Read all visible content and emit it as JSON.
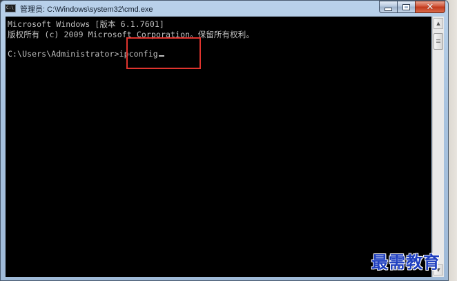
{
  "window": {
    "title": "管理员: C:\\Windows\\system32\\cmd.exe",
    "icon": "cmd-icon",
    "icon_label": "C:\\",
    "controls": {
      "minimize_icon": "minimize-icon",
      "maximize_icon": "maximize-icon",
      "close_icon": "close-icon",
      "close_glyph": "✕"
    }
  },
  "console": {
    "line1": "Microsoft Windows [版本 6.1.7601]",
    "line2": "版权所有 (c) 2009 Microsoft Corporation。保留所有权利。",
    "prompt": "C:\\Users\\Administrator>",
    "command": "ipconfig",
    "text_color": "#c0c0c0",
    "background_color": "#000000"
  },
  "annotation": {
    "highlight_color": "#e0342e"
  },
  "scrollbar": {
    "up_arrow": "▲",
    "down_arrow": "▼"
  },
  "watermark": {
    "text": "最需教育"
  }
}
